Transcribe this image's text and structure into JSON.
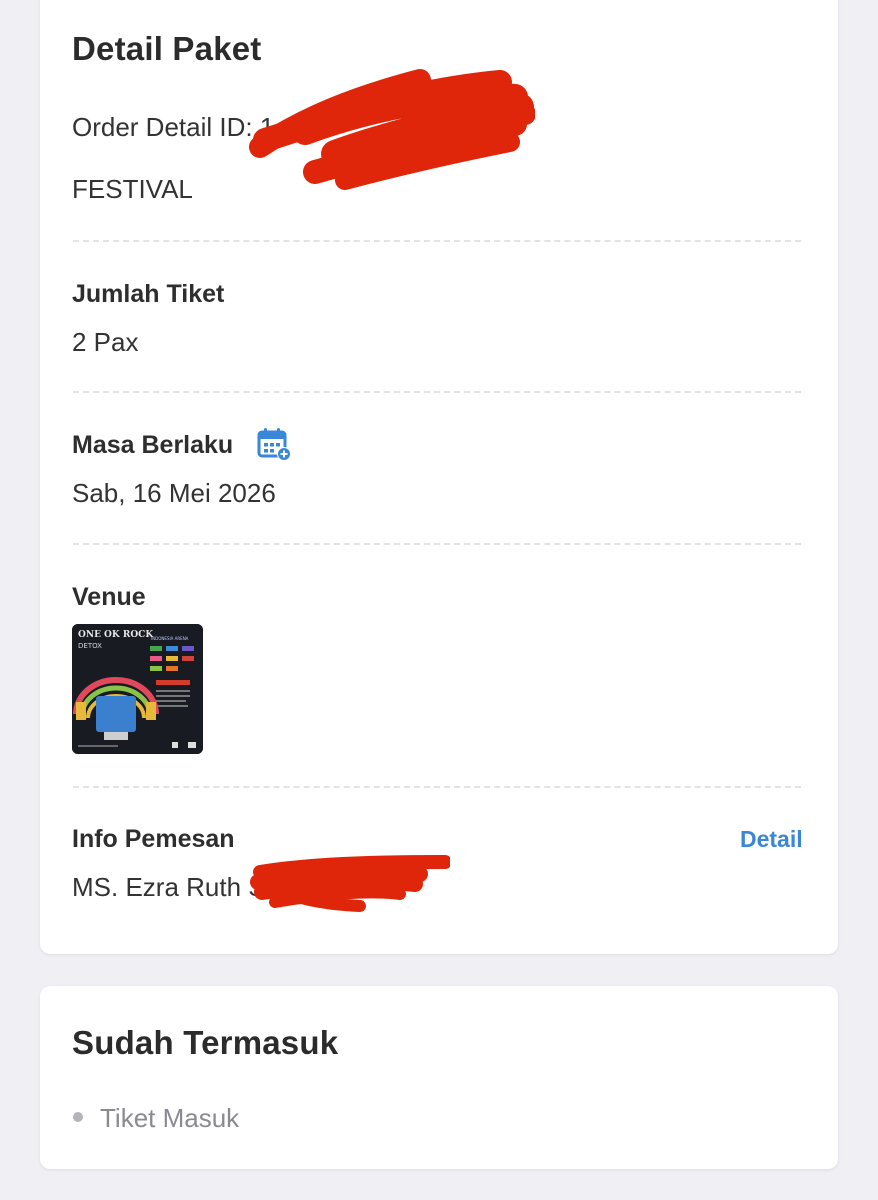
{
  "detail_paket": {
    "title": "Detail Paket",
    "order_detail_label": "Order Detail ID: 1",
    "category": "FESTIVAL"
  },
  "jumlah_tiket": {
    "label": "Jumlah Tiket",
    "value": "2 Pax"
  },
  "masa_berlaku": {
    "label": "Masa Berlaku",
    "icon": "calendar-add-icon",
    "value": "Sab, 16 Mei 2026"
  },
  "venue": {
    "label": "Venue",
    "map_title_line1": "ONE OK ROCK",
    "map_title_line2": "DETOX",
    "map_header": "INDONESIA ARENA"
  },
  "info_pemesan": {
    "label": "Info Pemesan",
    "detail_link": "Detail",
    "name": "MS. Ezra Ruth S"
  },
  "sudah_termasuk": {
    "title": "Sudah Termasuk",
    "items": [
      "Tiket Masuk"
    ]
  },
  "colors": {
    "background": "#efeff4",
    "card": "#ffffff",
    "link": "#3a86d8",
    "redaction": "#e0260a",
    "calendar_icon": "#3a86d8"
  }
}
